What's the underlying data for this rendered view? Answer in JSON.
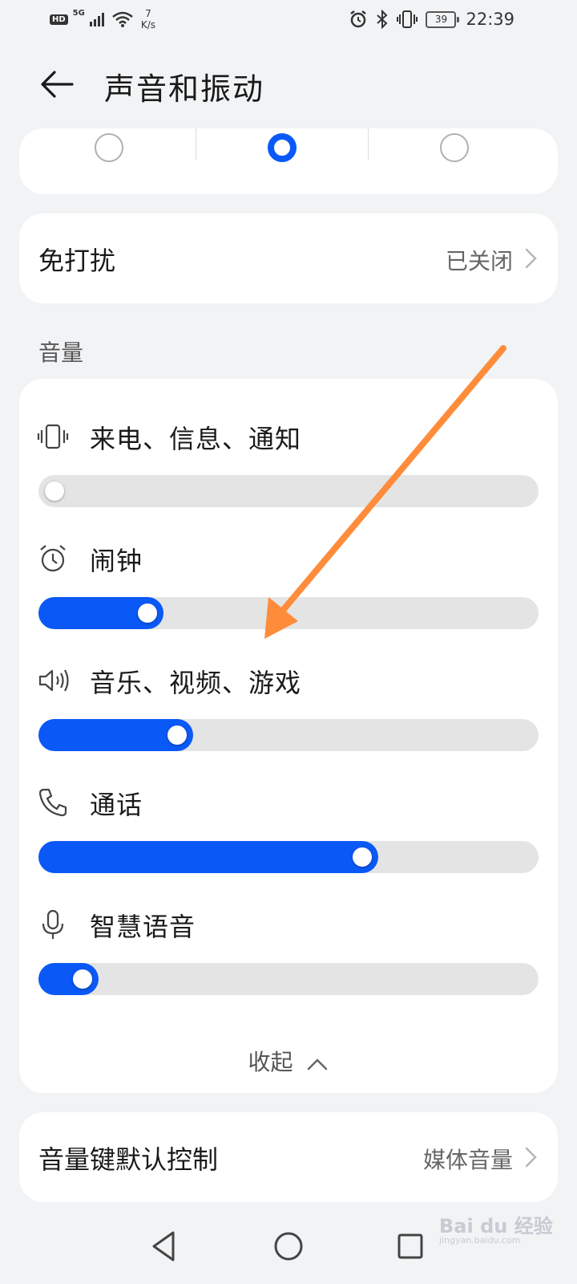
{
  "status_bar": {
    "hd": "HD",
    "network": "5G",
    "speed_value": "7",
    "speed_unit": "K/s",
    "battery": "39",
    "time": "22:39"
  },
  "header": {
    "title": "声音和振动"
  },
  "sound_modes": {
    "selected_index": 1,
    "count": 3
  },
  "dnd": {
    "label": "免打扰",
    "value": "已关闭"
  },
  "volume_section": {
    "label": "音量"
  },
  "volumes": [
    {
      "label": "来电、信息、通知",
      "icon": "vibrate-icon",
      "level": 0.0
    },
    {
      "label": "闹钟",
      "icon": "alarm-icon",
      "level": 0.25
    },
    {
      "label": "音乐、视频、游戏",
      "icon": "speaker-icon",
      "level": 0.31
    },
    {
      "label": "通话",
      "icon": "phone-icon",
      "level": 0.68
    },
    {
      "label": "智慧语音",
      "icon": "mic-icon",
      "level": 0.12
    }
  ],
  "collapse_label": "收起",
  "volume_key": {
    "label": "音量键默认控制",
    "value": "媒体音量"
  },
  "watermark": {
    "brand": "Bai du 经验",
    "url": "jingyan.baidu.com"
  },
  "colors": {
    "accent": "#0a59f7",
    "arrow": "#ff8c3a"
  }
}
